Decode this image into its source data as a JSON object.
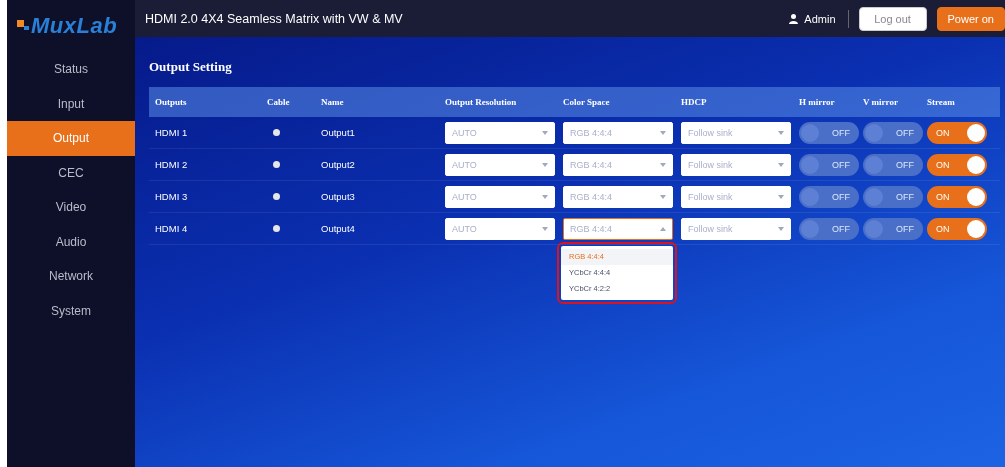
{
  "logo": "MuxLab",
  "header": {
    "title": "HDMI 2.0 4X4 Seamless Matrix with VW & MV",
    "user": "Admin",
    "buttons": [
      {
        "label": "Log out",
        "kind": "secondary"
      },
      {
        "label": "Power on",
        "kind": "primary"
      }
    ]
  },
  "sidebar": {
    "items": [
      {
        "label": "Status",
        "selected": false
      },
      {
        "label": "Input",
        "selected": false
      },
      {
        "label": "Output",
        "selected": true
      },
      {
        "label": "CEC",
        "selected": false
      },
      {
        "label": "Video",
        "selected": false
      },
      {
        "label": "Audio",
        "selected": false
      },
      {
        "label": "Network",
        "selected": false
      },
      {
        "label": "System",
        "selected": false
      }
    ]
  },
  "section_title": "Output Setting",
  "table": {
    "columns": [
      "Outputs",
      "Cable",
      "Name",
      "Output Resolution",
      "Color Space",
      "HDCP",
      "H mirror",
      "V mirror",
      "Stream"
    ],
    "rows": [
      {
        "output": "HDMI 1",
        "cable_connected": false,
        "name": "Output1",
        "resolution": {
          "value": "AUTO",
          "expanded": false
        },
        "color_space": {
          "value": "RGB 4:4:4",
          "expanded": false
        },
        "hdcp": {
          "value": "Follow sink",
          "expanded": false
        },
        "h_mirror": {
          "label": "OFF",
          "on": false,
          "disabled": true
        },
        "v_mirror": {
          "label": "OFF",
          "on": false,
          "disabled": true
        },
        "stream": {
          "label": "ON",
          "on": true,
          "disabled": false
        }
      },
      {
        "output": "HDMI 2",
        "cable_connected": false,
        "name": "Output2",
        "resolution": {
          "value": "AUTO",
          "expanded": false
        },
        "color_space": {
          "value": "RGB 4:4:4",
          "expanded": false
        },
        "hdcp": {
          "value": "Follow sink",
          "expanded": false
        },
        "h_mirror": {
          "label": "OFF",
          "on": false,
          "disabled": true
        },
        "v_mirror": {
          "label": "OFF",
          "on": false,
          "disabled": true
        },
        "stream": {
          "label": "ON",
          "on": true,
          "disabled": false
        }
      },
      {
        "output": "HDMI 3",
        "cable_connected": false,
        "name": "Output3",
        "resolution": {
          "value": "AUTO",
          "expanded": false
        },
        "color_space": {
          "value": "RGB 4:4:4",
          "expanded": false
        },
        "hdcp": {
          "value": "Follow sink",
          "expanded": false
        },
        "h_mirror": {
          "label": "OFF",
          "on": false,
          "disabled": true
        },
        "v_mirror": {
          "label": "OFF",
          "on": false,
          "disabled": true
        },
        "stream": {
          "label": "ON",
          "on": true,
          "disabled": false
        }
      },
      {
        "output": "HDMI 4",
        "cable_connected": false,
        "name": "Output4",
        "resolution": {
          "value": "AUTO",
          "expanded": false
        },
        "color_space": {
          "value": "RGB 4:4:4",
          "expanded": true,
          "highlighted": true,
          "options": [
            {
              "label": "RGB 4:4:4",
              "selected": true
            },
            {
              "label": "YCbCr 4:4:4",
              "selected": false
            },
            {
              "label": "YCbCr 4:2:2",
              "selected": false
            }
          ]
        },
        "hdcp": {
          "value": "Follow sink",
          "expanded": false
        },
        "h_mirror": {
          "label": "OFF",
          "on": false,
          "disabled": true
        },
        "v_mirror": {
          "label": "OFF",
          "on": false,
          "disabled": true
        },
        "stream": {
          "label": "ON",
          "on": true,
          "disabled": false
        }
      }
    ]
  }
}
